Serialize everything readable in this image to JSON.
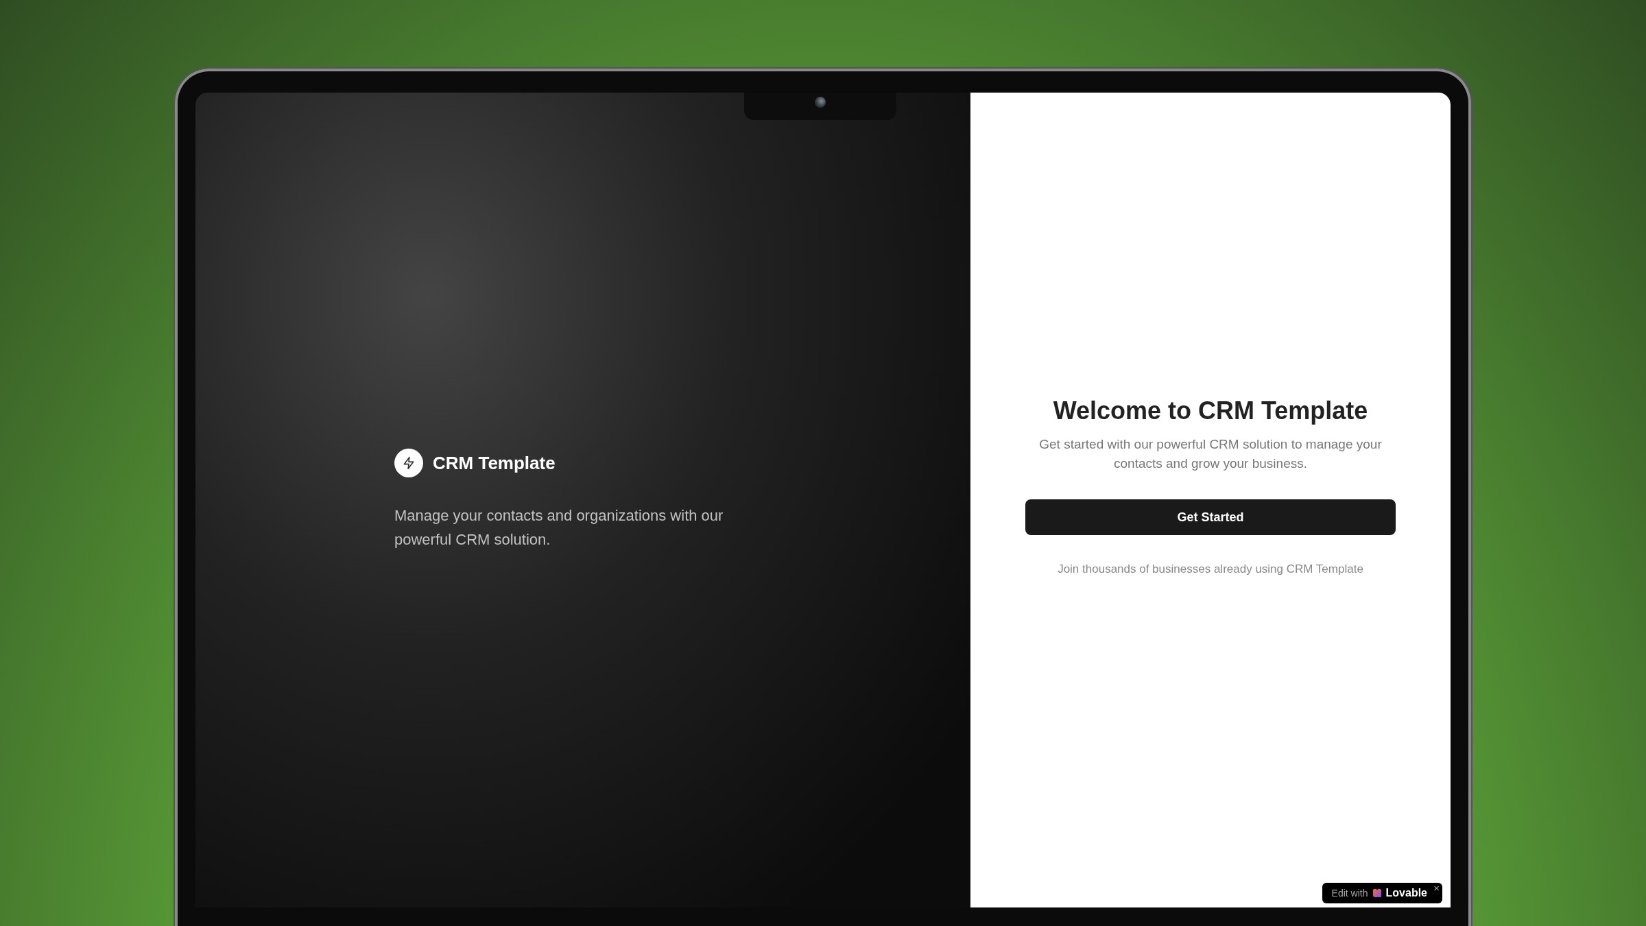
{
  "brand_panel": {
    "title": "CRM Template",
    "tagline": "Manage your contacts and organizations with our powerful CRM solution."
  },
  "welcome_panel": {
    "heading": "Welcome to CRM Template",
    "subtitle": "Get started with our powerful CRM solution to manage your contacts and grow your business.",
    "button": "Get Started",
    "footnote": "Join thousands of businesses already using CRM Template"
  },
  "edit_badge": {
    "prefix": "Edit with",
    "brand": "Lovable",
    "close": "×"
  }
}
